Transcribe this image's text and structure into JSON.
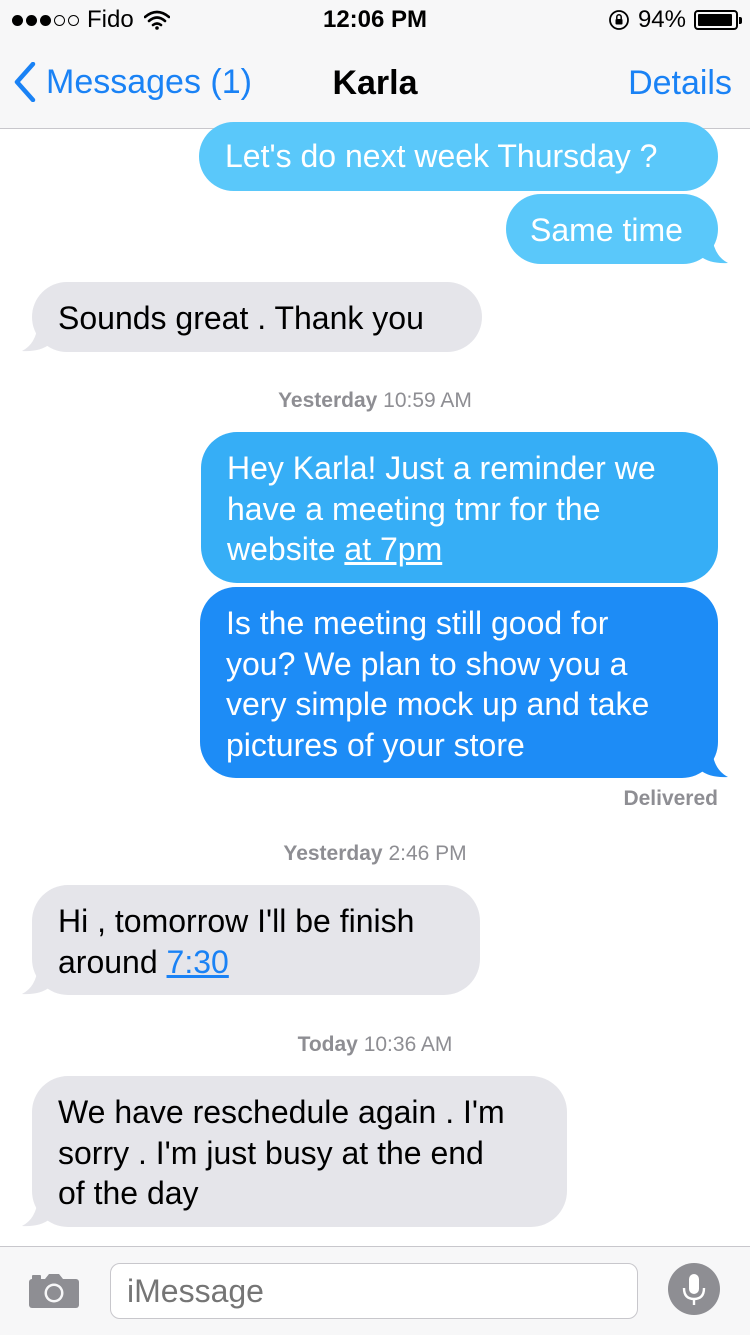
{
  "status_bar": {
    "carrier": "Fido",
    "signal_dots_filled": 3,
    "signal_dots_total": 5,
    "time": "12:06 PM",
    "battery_percent": "94%",
    "battery_level": 0.94
  },
  "nav": {
    "back_label": "Messages (1)",
    "title": "Karla",
    "details_label": "Details"
  },
  "messages": {
    "m1": "Let's do next week Thursday ?",
    "m2": "Same time",
    "m3": "Sounds great . Thank you",
    "ts1": {
      "day": "Yesterday",
      "time": "10:59 AM"
    },
    "m4": {
      "line1": "Hey Karla! Just a reminder we",
      "line2": "have a meeting tmr for the",
      "line3_prefix": "website ",
      "line3_link": "at 7pm"
    },
    "m5": {
      "line1": "Is the meeting still good for",
      "line2": "you? We plan to show you a",
      "line3": "very simple mock up and take",
      "line4": "pictures of your store"
    },
    "delivered": "Delivered",
    "ts2": {
      "day": "Yesterday",
      "time": "2:46 PM"
    },
    "m6": {
      "line1": "Hi , tomorrow I'll be finish",
      "line2_prefix": "around ",
      "line2_link": "7:30"
    },
    "ts3": {
      "day": "Today",
      "time": "10:36 AM"
    },
    "m7": {
      "line1": "We have reschedule again . I'm",
      "line2": "sorry . I'm just busy at the end",
      "line3": "of the day"
    }
  },
  "input_bar": {
    "placeholder": "iMessage"
  },
  "colors": {
    "accent": "#1a82f5",
    "bubble_out_light": "#5ac8fa",
    "bubble_out_dark": "#1a82f5",
    "bubble_in": "#e5e5ea",
    "secondary_text": "#8e8e93"
  },
  "icons": [
    "back-chevron-icon",
    "wifi-icon",
    "rotation-lock-icon",
    "battery-icon",
    "camera-icon",
    "microphone-icon"
  ]
}
